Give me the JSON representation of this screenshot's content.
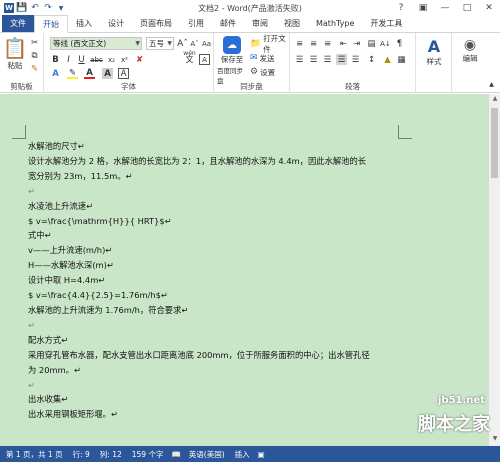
{
  "window": {
    "title": "文档2 - Word(产品激活失败)"
  },
  "tabs": [
    "文件",
    "开始",
    "插入",
    "设计",
    "页面布局",
    "引用",
    "邮件",
    "审阅",
    "视图",
    "MathType",
    "开发工具"
  ],
  "ribbon": {
    "clipboard": {
      "label": "剪贴板",
      "paste": "粘贴"
    },
    "font": {
      "label": "字体",
      "font_name": "等线 (西文正文)",
      "font_size": "五号",
      "wen": "wén",
      "A": "A"
    },
    "baidu": {
      "label": "同步盘",
      "save": "保存至",
      "save2": "百度同步盘",
      "open": "打开文件",
      "send": "发送",
      "settings": "设置"
    },
    "paragraph": {
      "label": "段落"
    },
    "styles": {
      "label": "样式"
    },
    "editing": {
      "label": "编辑"
    }
  },
  "document": {
    "lines": [
      "水解池的尺寸↵",
      "设计水解池分为 2 格，水解池的长宽比为 2：1，且水解池的水深为 4.4m，因此水解池的长",
      "宽分别为 23m，11.5m。↵",
      "↵",
      "水凌池上升流速↵",
      "$ v=\\frac{\\mathrm{H}}{ HRT}$↵",
      "式中↵",
      "v——上升流速(m/h)↵",
      "H——水解池水深(m)↵",
      "设计中取 H=4.4m↵",
      "$ v=\\frac{4.4}{2.5}=1.76m/h$↵",
      "水解池的上升流速为 1.76m/h，符合要求↵",
      "↵",
      "配水方式↵",
      "采用穿孔管布水器，配水支管出水口距离池底 200mm，位于所服务面积的中心；出水管孔径",
      "为 20mm。↵",
      "↵",
      "出水收集↵",
      "出水采用钢板矩形堰。↵"
    ]
  },
  "status": {
    "page": "第 1 页，共 1 页",
    "row": "行: 9",
    "col": "列: 12",
    "chars": "159 个字",
    "lang": "英语(美国)",
    "mode": "插入"
  },
  "watermark": {
    "site": "jb51.net",
    "brand": "脚本之家"
  }
}
